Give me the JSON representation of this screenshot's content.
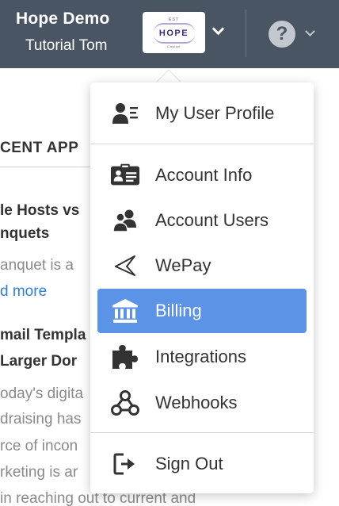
{
  "header": {
    "org_name": "Hope Demo",
    "user_name": "Tutorial Tom",
    "logo": {
      "top": "EST",
      "main": "HOPE",
      "bottom": "Capital"
    },
    "help_glyph": "?"
  },
  "background": {
    "section_heading": "CENT APP",
    "lines": [
      "le Hosts vs",
      "nquets",
      "anquet is a",
      "d more",
      "mail Templa",
      " Larger Dor",
      "oday's digita",
      "draising has",
      "rce of incon",
      "rketing is ar",
      " in reaching out to current and"
    ]
  },
  "menu": {
    "profile": {
      "label": "My User Profile",
      "icon": "user-profile-icon"
    },
    "items": [
      {
        "label": "Account Info",
        "icon": "id-card-icon"
      },
      {
        "label": "Account Users",
        "icon": "users-icon"
      },
      {
        "label": "WePay",
        "icon": "wepay-icon"
      },
      {
        "label": "Billing",
        "icon": "bank-icon",
        "active": true
      },
      {
        "label": "Integrations",
        "icon": "puzzle-icon"
      },
      {
        "label": "Webhooks",
        "icon": "webhooks-icon"
      }
    ],
    "sign_out": {
      "label": "Sign Out",
      "icon": "sign-out-icon"
    }
  },
  "colors": {
    "header_bg": "#4a5563",
    "active_item": "#5b93e6",
    "link": "#2f7ed8",
    "icon": "#333333"
  }
}
